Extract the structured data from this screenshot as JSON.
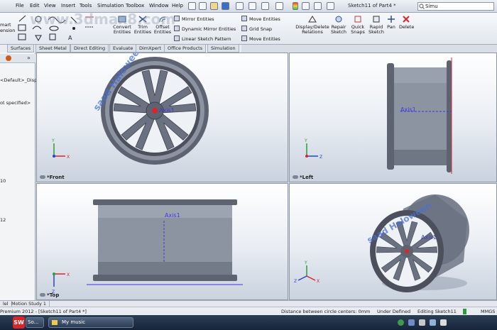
{
  "menu": {
    "items": [
      "File",
      "Edit",
      "View",
      "Insert",
      "Tools",
      "Simulation",
      "Toolbox",
      "Window",
      "Help"
    ],
    "window_title": "Sketch11 of Part4 *",
    "search_text": "Simu"
  },
  "toolbar": {
    "left_labels": [
      "mart",
      "ension"
    ],
    "convert": "Convert\nEntities",
    "trim": "Trim\nEntities",
    "offset": "Offset\nEntities",
    "mirror": "Mirror Entities",
    "dyn_mirror": "Dynamic Mirror Entities",
    "linear_pattern": "Linear Sketch Pattern",
    "move1": "Move Entities",
    "grid": "Grid Snap",
    "move2": "Move Entities",
    "display_delete": "Display/Delete\nRelations",
    "repair": "Repair\nSketch",
    "quick_snaps": "Quick\nSnaps",
    "rapid": "Rapid\nSketch",
    "pan": "Pan",
    "delete": "Delete"
  },
  "tabs": [
    "Surfaces",
    "Sheet Metal",
    "Direct Editing",
    "Evaluate",
    "DimXpert",
    "Office Products",
    "Simulation"
  ],
  "left_panel": {
    "tab_marker": "b",
    "line1": "<Default>_Disp",
    "line2": "ot specified>",
    "num1": "10",
    "num2": "12"
  },
  "views": {
    "front": "*Front",
    "left": "*Left",
    "top": "*Top",
    "axis_label": "Axis1",
    "watermark": "saad Haloween"
  },
  "bottom_tabs": [
    "lel",
    "Motion Study 1"
  ],
  "status": {
    "app": "Premium 2012 - [Sketch11 of Part4 *]",
    "distance": "Distance between circle centers: 0mm",
    "defined": "Under Defined",
    "editing": "Editing Sketch11",
    "units": "MMGS"
  },
  "taskbar": {
    "app_button": "So...",
    "music": "My music"
  },
  "watermark_site": "www.3dmax8.com",
  "colors": {
    "axis_blue": "#3b3bd6",
    "rim_gray": "#5d6370",
    "accent_red": "#d9262b"
  }
}
